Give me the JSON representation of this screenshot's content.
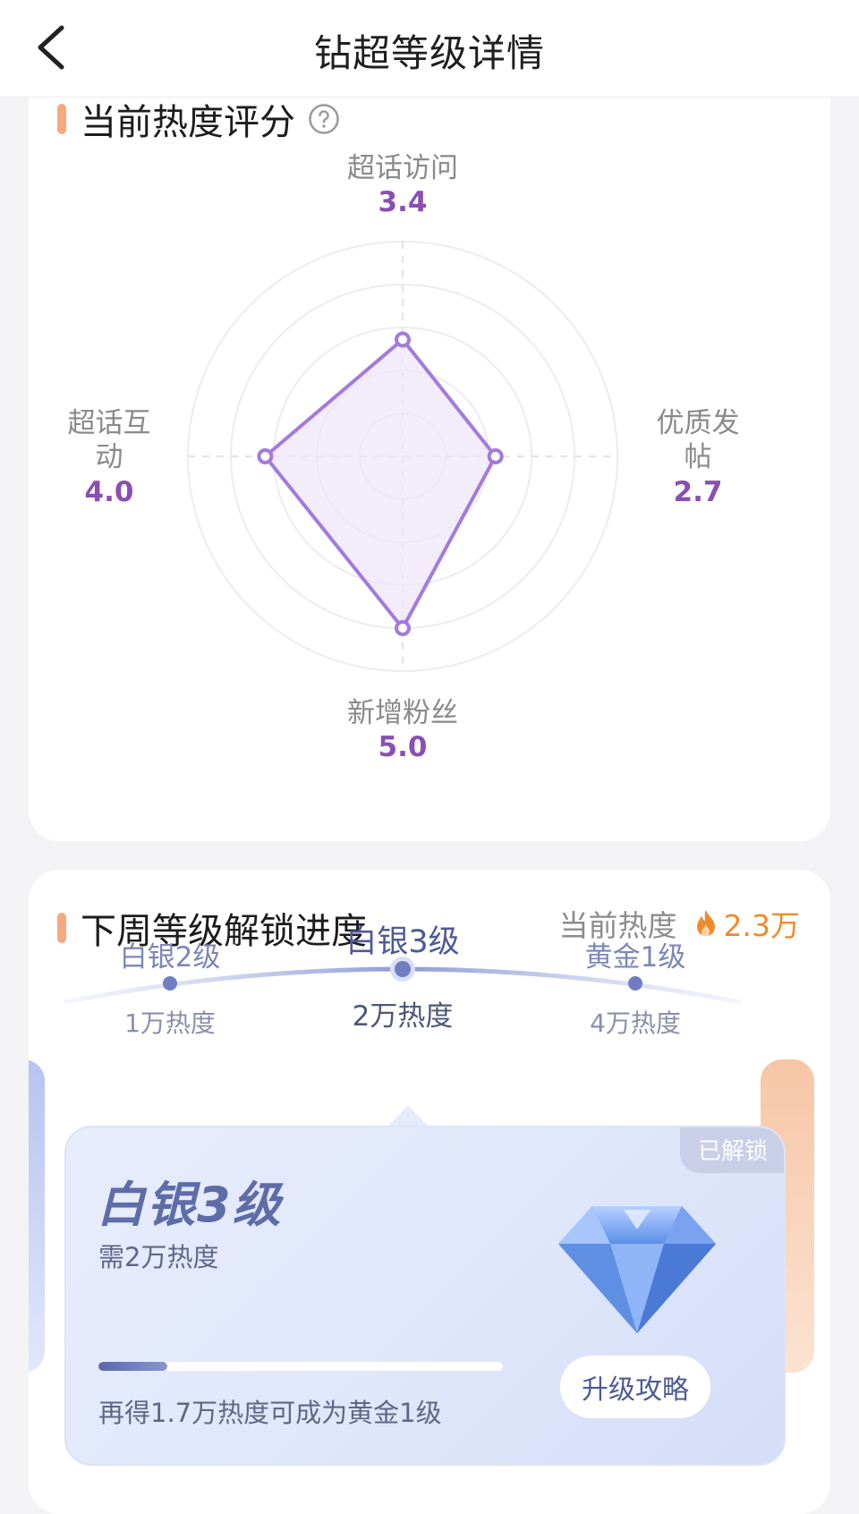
{
  "header": {
    "title": "钻超等级详情",
    "back_icon": "chevron-left-icon"
  },
  "score_section": {
    "title": "当前热度评分",
    "help_icon": "question-circle-icon",
    "radar": {
      "axes": [
        {
          "label": "超话访问",
          "value": "3.4",
          "score": 3.4
        },
        {
          "label": "优质发帖",
          "value": "2.7",
          "score": 2.7
        },
        {
          "label": "新增粉丝",
          "value": "5.0",
          "score": 5.0
        },
        {
          "label": "超话互动",
          "value": "4.0",
          "score": 4.0
        }
      ],
      "max": 5,
      "colors": {
        "line": "#a27bdc",
        "fill": "#ede6fa",
        "value": "#8a4fb3"
      }
    }
  },
  "unlock_section": {
    "title": "下周等级解锁进度",
    "current_heat_label": "当前热度",
    "current_heat_value": "2.3万",
    "fire_icon": "flame-icon",
    "levels": [
      {
        "name": "白银2级",
        "heat": "1万热度"
      },
      {
        "name": "白银3级",
        "heat": "2万热度",
        "active": true
      },
      {
        "name": "黄金1级",
        "heat": "4万热度"
      }
    ],
    "card": {
      "badge": "已解锁",
      "level_name": "白银3级",
      "need": "需2万热度",
      "progress_fraction": 0.17,
      "tip": "再得1.7万热度可成为黄金1级",
      "guide_button": "升级攻略",
      "gem_icon": "diamond-icon"
    }
  },
  "colors": {
    "accent_bar": "#f6a97d",
    "heat_orange": "#f08a2e",
    "level_blue": "#5e6ca8"
  }
}
